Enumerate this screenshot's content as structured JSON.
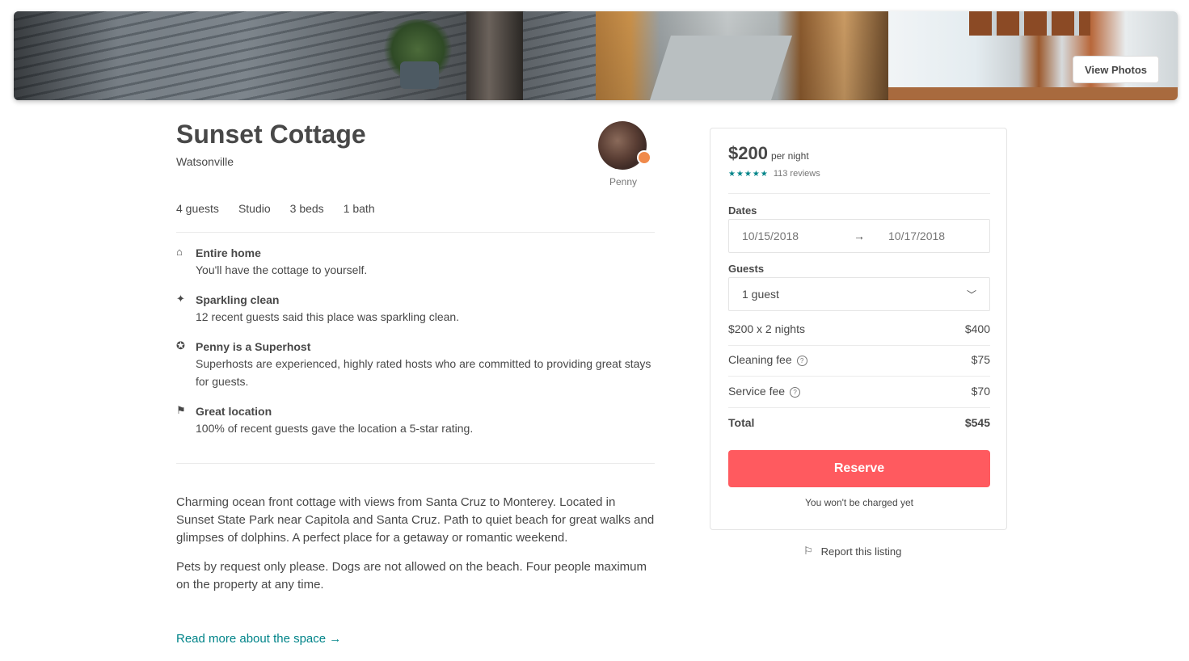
{
  "gallery": {
    "view_photos_label": "View Photos"
  },
  "listing": {
    "title": "Sunset Cottage",
    "city": "Watsonville",
    "host_name": "Penny",
    "specs": [
      "4 guests",
      "Studio",
      "3 beds",
      "1 bath"
    ]
  },
  "highlights": [
    {
      "icon": "home-icon",
      "title": "Entire home",
      "desc": "You'll have the cottage to yourself."
    },
    {
      "icon": "sparkle-icon",
      "title": "Sparkling clean",
      "desc": "12 recent guests said this place was sparkling clean."
    },
    {
      "icon": "medal-icon",
      "title": "Penny is a Superhost",
      "desc": "Superhosts are experienced, highly rated hosts who are committed to providing great stays for guests."
    },
    {
      "icon": "location-pin-icon",
      "title": "Great location",
      "desc": "100% of recent guests gave the location a 5-star rating."
    }
  ],
  "description": {
    "paragraph_1": "Charming ocean front cottage with views from Santa Cruz to Monterey. Located in Sunset State Park near Capitola and Santa Cruz. Path to quiet beach for great walks and glimpses of dolphins. A perfect place for a getaway or romantic weekend.",
    "paragraph_2": "Pets by request only please. Dogs are not allowed on the beach. Four people maximum on the property at any time.",
    "read_more": "Read more about the space →"
  },
  "booking": {
    "price": "$200",
    "per_night": "per night",
    "stars": "★★★★★",
    "reviews": "113 reviews",
    "dates_label": "Dates",
    "check_in": "10/15/2018",
    "arrow": "→",
    "check_out": "10/17/2018",
    "guests_label": "Guests",
    "guests_value": "1 guest",
    "nightly_label": "$200 x 2 nights",
    "nightly_value": "$400",
    "cleaning_label": "Cleaning fee",
    "cleaning_value": "$75",
    "service_label": "Service fee",
    "service_value": "$70",
    "total_label": "Total",
    "total_value": "$545",
    "reserve_label": "Reserve",
    "note": "You won't be charged yet",
    "report_label": "Report this listing"
  }
}
